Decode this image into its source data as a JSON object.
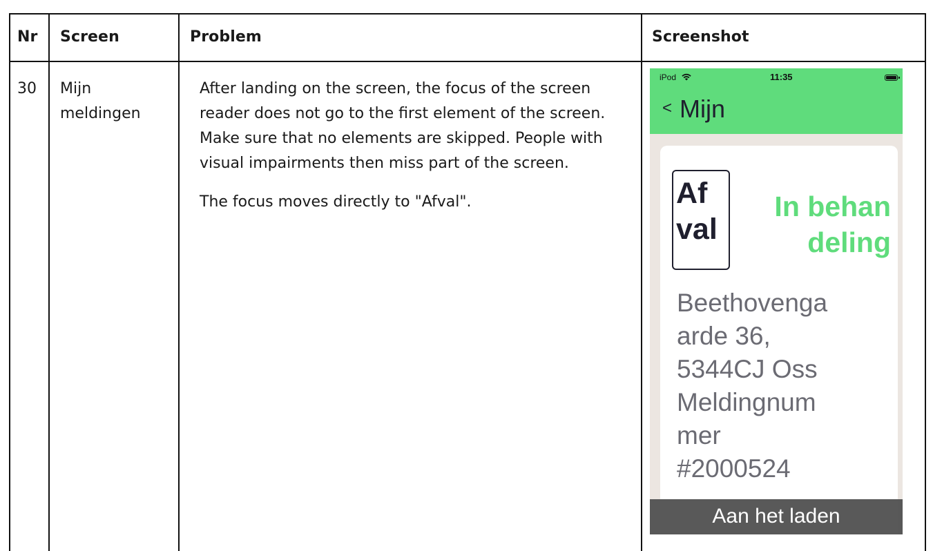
{
  "table": {
    "headers": {
      "nr": "Nr",
      "screen": "Screen",
      "problem": "Problem",
      "screenshot": "Screenshot"
    },
    "row": {
      "nr": "30",
      "screen_line1": "Mijn",
      "screen_line2": "meldingen",
      "problem_p1": "After landing on the screen, the focus of the screen reader does not go to the first element of the screen. Make sure that no elements are skipped. People with visual impairments then miss part of the screen.",
      "problem_p2": "The focus moves directly to \"Afval\"."
    }
  },
  "phone": {
    "carrier": "iPod",
    "time": "11:35",
    "back_chevron": "<",
    "title": "Mijn",
    "tag_line1": "Af",
    "tag_line2": "val",
    "status_line1": "In behan",
    "status_line2": "deling",
    "address_line1": "Beethovenga",
    "address_line2": "arde 36,",
    "address_line3": "5344CJ Oss",
    "number_line1": "Meldingnum",
    "number_line2": "mer",
    "number_line3": "#2000524",
    "loading_text": "Aan het laden",
    "header_color": "#5fdc7c",
    "background_color": "#ece6e1"
  }
}
